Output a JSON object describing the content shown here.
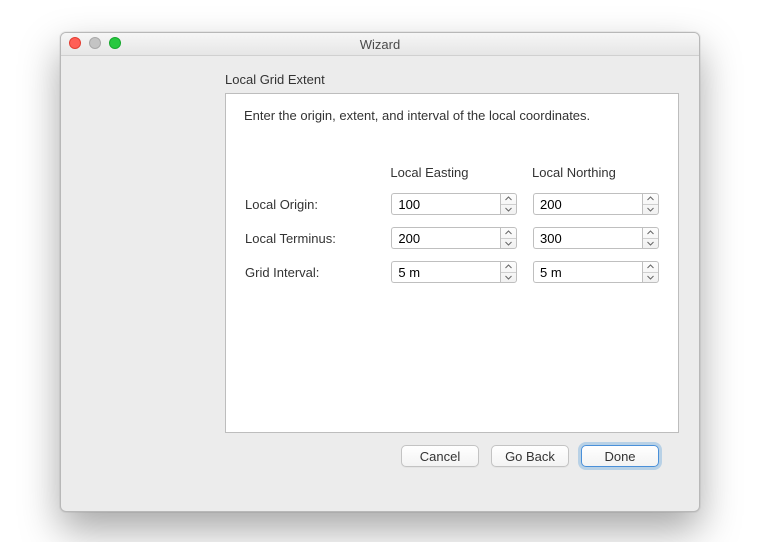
{
  "window": {
    "title": "Wizard"
  },
  "section": {
    "title": "Local Grid Extent",
    "instruction": "Enter the origin, extent, and interval of the local coordinates."
  },
  "columns": {
    "easting": "Local Easting",
    "northing": "Local Northing"
  },
  "rows": {
    "origin": {
      "label": "Local Origin:",
      "easting": "100",
      "northing": "200"
    },
    "terminus": {
      "label": "Local Terminus:",
      "easting": "200",
      "northing": "300"
    },
    "interval": {
      "label": "Grid Interval:",
      "easting": "5 m",
      "northing": "5 m"
    }
  },
  "buttons": {
    "cancel": "Cancel",
    "goback": "Go Back",
    "done": "Done"
  }
}
